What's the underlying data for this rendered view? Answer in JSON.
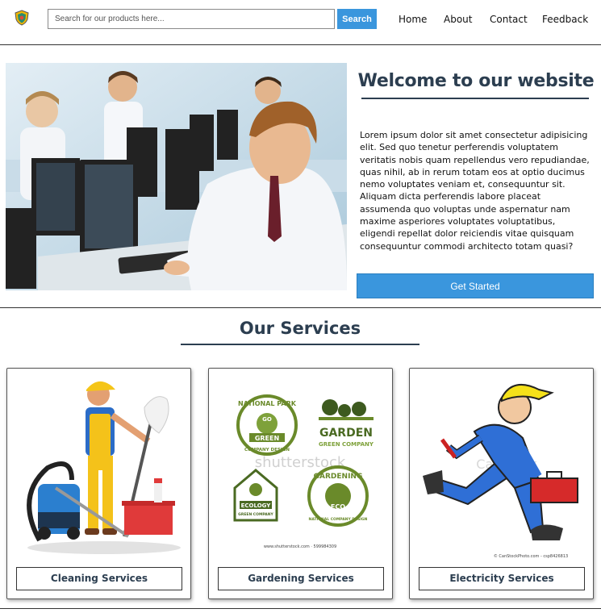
{
  "nav": {
    "search_placeholder": "Search for our products here...",
    "search_button": "Search",
    "links": [
      "Home",
      "About",
      "Contact",
      "Feedback"
    ]
  },
  "hero": {
    "title": "Welcome to our website",
    "body": "Lorem ipsum dolor sit amet consectetur adipisicing elit. Sed quo tenetur perferendis voluptatem veritatis nobis quam repellendus vero repudiandae, quas nihil, ab in rerum totam eos at optio ducimus nemo voluptates veniam et, consequuntur sit. Aliquam dicta perferendis labore placeat assumenda quo voluptas unde aspernatur nam maxime asperiores voluptates voluptatibus, eligendi repellat dolor reiciendis vitae quisquam consequuntur commodi architecto totam quasi?",
    "cta": "Get Started"
  },
  "services": {
    "title": "Our Services",
    "cards": [
      {
        "label": "Cleaning Services"
      },
      {
        "label": "Gardening Services",
        "watermark": "shutterstock",
        "badges": [
          "NATIONAL PARK",
          "GO",
          "GREEN",
          "COMPANY DESIGN",
          "GARDEN",
          "GREEN COMPANY",
          "ECOLOGY",
          "GREEN COMPANY",
          "GARDENING",
          "ECO",
          "NATIONAL COMPANY DESIGN"
        ],
        "credit": "www.shutterstock.com · 599984309"
      },
      {
        "label": "Electricity Services",
        "watermark": "CanStock",
        "credit": "© CanStockPhoto.com - csp8426813"
      }
    ]
  },
  "colors": {
    "accent": "#3a96dd",
    "heading": "#2c3e50",
    "divider": "#333333"
  }
}
